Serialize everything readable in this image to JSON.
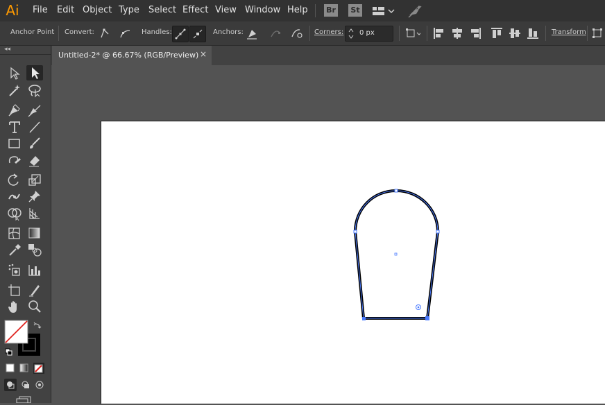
{
  "app": {
    "logo": "Ai"
  },
  "menu": [
    "File",
    "Edit",
    "Object",
    "Type",
    "Select",
    "Effect",
    "View",
    "Window",
    "Help"
  ],
  "menu_icons": {
    "bridge": "Br",
    "stock": "St",
    "workspace": "grid-workspace-icon",
    "gpu": "rocket-gpu-icon"
  },
  "control_bar": {
    "tool_label": "Anchor Point",
    "convert_label": "Convert:",
    "handles_label": "Handles:",
    "anchors_label": "Anchors:",
    "corners_label": "Corners:",
    "corners_value": "0 px",
    "transform_label": "Transform"
  },
  "document_tab": {
    "title": "Untitled-2* @ 66.67% (RGB/Preview)",
    "close": "×"
  },
  "toolbar": {
    "grip": "◂◂"
  },
  "colors": {
    "accent": "#4a7bff",
    "stroke": "#000000",
    "fill": "#ffffff",
    "none_slash": "#e0201b"
  }
}
